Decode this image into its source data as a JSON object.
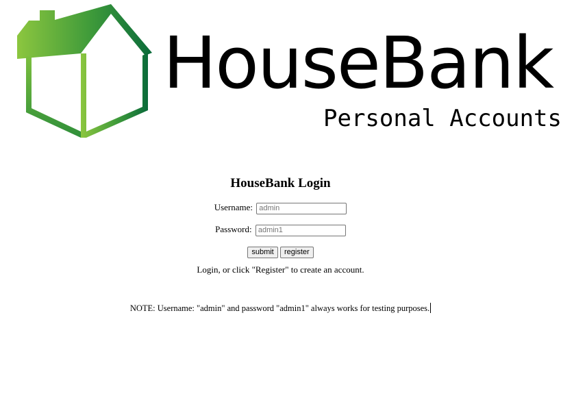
{
  "brand": {
    "name": "HouseBank",
    "subtitle": "Personal Accounts",
    "logo_icon": "house-icon",
    "colors": {
      "green_light": "#8cc63f",
      "green_dark": "#0a6b3a"
    }
  },
  "login": {
    "title": "HouseBank Login",
    "username_label": "Username:",
    "username_placeholder": "admin",
    "password_label": "Password:",
    "password_placeholder": "admin1",
    "submit_label": "submit",
    "register_label": "register",
    "hint": "Login, or click \"Register\" to create an account."
  },
  "note": "NOTE: Username: \"admin\" and password \"admin1\" always works for testing purposes."
}
